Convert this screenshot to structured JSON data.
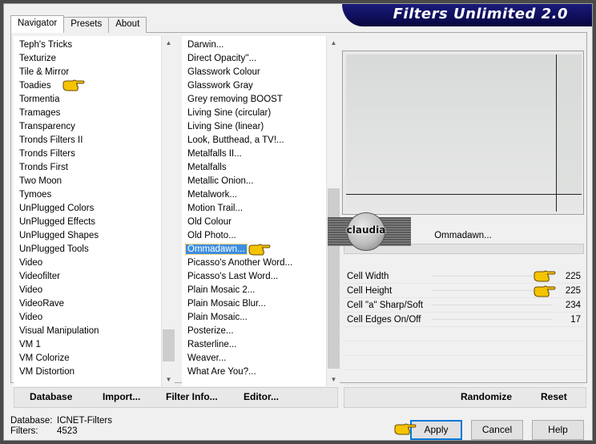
{
  "window": {
    "title": "Filters Unlimited 2.0"
  },
  "tabs": [
    {
      "label": "Navigator",
      "active": true
    },
    {
      "label": "Presets",
      "active": false
    },
    {
      "label": "About",
      "active": false
    }
  ],
  "categories": {
    "items": [
      "Teph's Tricks",
      "Texturize",
      "Tile & Mirror",
      "Toadies",
      "Tormentia",
      "Tramages",
      "Transparency",
      "Tronds Filters II",
      "Tronds Filters",
      "Tronds First",
      "Two Moon",
      "Tymoes",
      "UnPlugged Colors",
      "UnPlugged Effects",
      "UnPlugged Shapes",
      "UnPlugged Tools",
      "Video",
      "Videofilter",
      "Video",
      "VideoRave",
      "Video",
      "Visual Manipulation",
      "VM 1",
      "VM Colorize",
      "VM Distortion"
    ],
    "selected": "Toadies"
  },
  "filters": {
    "items": [
      "Darwin...",
      "Direct Opacity''...",
      "Glasswork Colour",
      "Glasswork Gray",
      "Grey removing BOOST",
      "Living Sine (circular)",
      "Living Sine (linear)",
      "Look, Butthead, a TV!...",
      "Metalfalls II...",
      "Metalfalls",
      "Metallic Onion...",
      "Metalwork...",
      "Motion Trail...",
      "Old Colour",
      "Old Photo...",
      "Ommadawn...",
      "Picasso's Another Word...",
      "Picasso's Last Word...",
      "Plain Mosaic 2...",
      "Plain Mosaic Blur...",
      "Plain Mosaic...",
      "Posterize...",
      "Rasterline...",
      "Weaver...",
      "What Are You?..."
    ],
    "selected": "Ommadawn..."
  },
  "preview": {
    "filter_name": "Ommadawn..."
  },
  "watermark": {
    "text": "claudia"
  },
  "params": [
    {
      "label": "Cell Width",
      "value": "225"
    },
    {
      "label": "Cell Height",
      "value": "225"
    },
    {
      "label": "Cell \"a\" Sharp/Soft",
      "value": "234"
    },
    {
      "label": "Cell Edges On/Off",
      "value": "17"
    }
  ],
  "left_buttons": {
    "database": "Database",
    "import": "Import...",
    "filter_info": "Filter Info...",
    "editor": "Editor..."
  },
  "right_buttons": {
    "randomize": "Randomize",
    "reset": "Reset"
  },
  "status": {
    "database_label": "Database:",
    "database_value": "ICNET-Filters",
    "filters_label": "Filters:",
    "filters_value": "4523"
  },
  "dialog_buttons": {
    "apply": "Apply",
    "cancel": "Cancel",
    "help": "Help"
  },
  "colors": {
    "banner": "#0e0e5a",
    "selection": "#3d8ee0",
    "hand": "#f5c400"
  }
}
